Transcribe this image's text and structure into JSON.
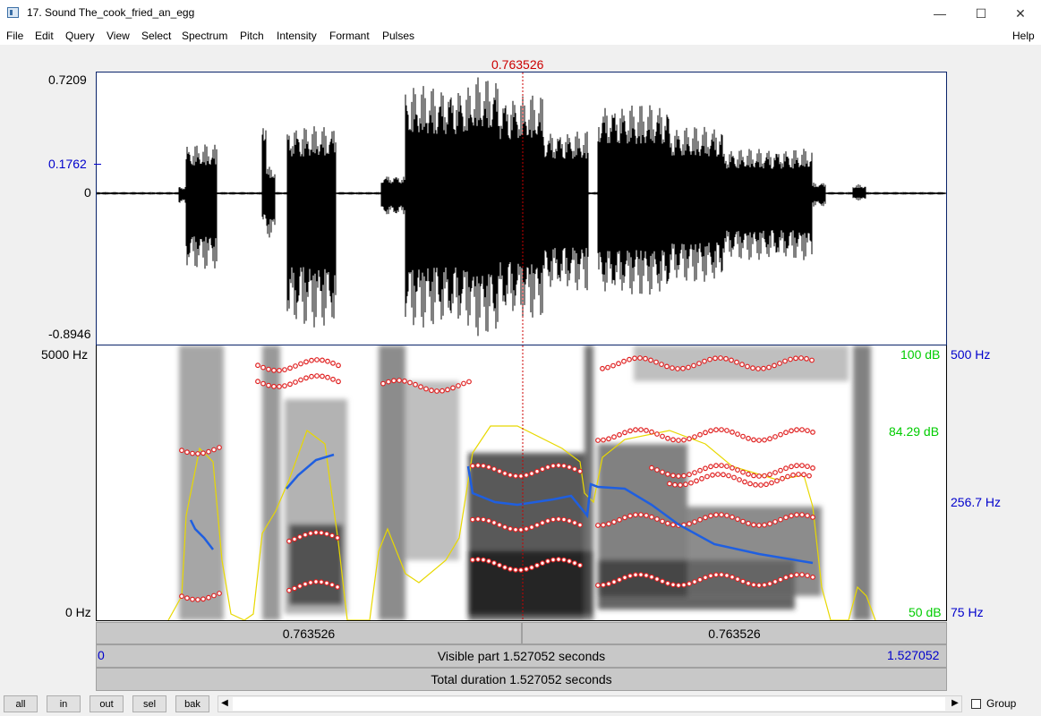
{
  "window": {
    "title": "17. Sound The_cook_fried_an_egg",
    "controls": {
      "minimize": "—",
      "maximize": "☐",
      "close": "✕"
    }
  },
  "menu": [
    "File",
    "Edit",
    "Query",
    "View",
    "Select",
    "Spectrum",
    "Pitch",
    "Intensity",
    "Formant",
    "Pulses"
  ],
  "help_label": "Help",
  "cursor_time": "0.763526",
  "waveform": {
    "max": "0.7209",
    "mid": "0.1762",
    "zero": "0",
    "min": "-0.8946"
  },
  "spectrogram": {
    "top_freq": "5000 Hz",
    "bottom_freq": "0 Hz",
    "intensity_top": "100 dB",
    "intensity_mid": "84.29 dB",
    "intensity_bottom": "50 dB",
    "pitch_top": "500 Hz",
    "pitch_mid": "256.7 Hz",
    "pitch_bottom": "75 Hz"
  },
  "segments": {
    "left": "0.763526",
    "right": "0.763526"
  },
  "visible": {
    "start": "0",
    "label": "Visible part 1.527052 seconds",
    "end": "1.527052"
  },
  "total": "Total duration 1.527052 seconds",
  "buttons": [
    "all",
    "in",
    "out",
    "sel",
    "bak"
  ],
  "group_label": "Group",
  "colors": {
    "pitch": "#1f5fe0",
    "formant": "#e02020",
    "intensity": "#f0e000",
    "cursor": "#cc0000",
    "axis_blue": "#0000cc",
    "axis_green": "#00cc00"
  }
}
